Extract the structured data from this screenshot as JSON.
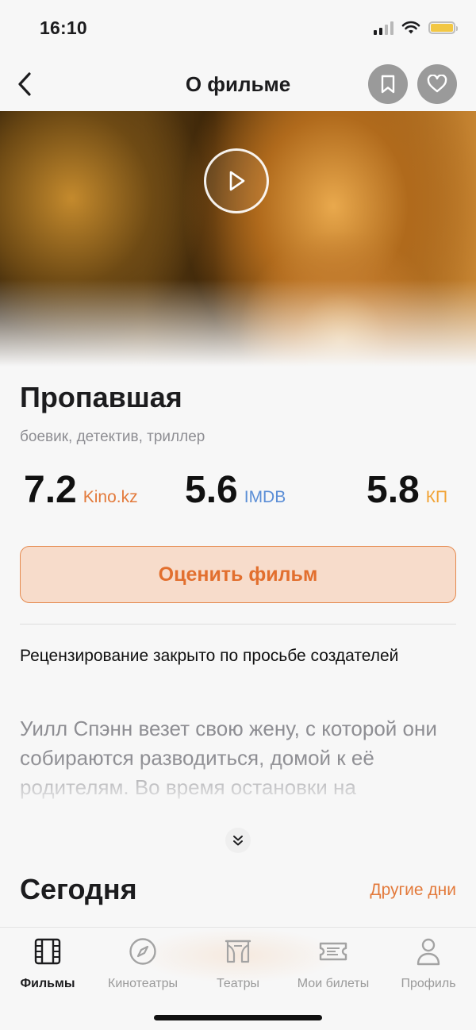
{
  "status_bar": {
    "time": "16:10"
  },
  "nav": {
    "title": "О фильме"
  },
  "movie": {
    "title": "Пропавшая",
    "genres": "боевик, детектив, триллер",
    "ratings": [
      {
        "value": "7.2",
        "source": "Kino.kz",
        "color": "#e37a3b"
      },
      {
        "value": "5.6",
        "source": "IMDB",
        "color": "#5b8ed6"
      },
      {
        "value": "5.8",
        "source": "КП",
        "color": "#f2a334"
      }
    ],
    "rate_button": "Оценить фильм",
    "review_note": "Рецензирование закрыто по просьбе создателей",
    "description": "Уилл Спэнн везет свою жену, с которой они собираются разводиться, домой к её родителям. Во время остановки на"
  },
  "schedule": {
    "title": "Сегодня",
    "other_days": "Другие дни"
  },
  "tabs": [
    {
      "label": "Фильмы",
      "icon": "film-icon",
      "active": true
    },
    {
      "label": "Кинотеатры",
      "icon": "compass-icon",
      "active": false
    },
    {
      "label": "Театры",
      "icon": "theater-icon",
      "active": false
    },
    {
      "label": "Мои билеты",
      "icon": "ticket-icon",
      "active": false
    },
    {
      "label": "Профиль",
      "icon": "profile-icon",
      "active": false
    }
  ],
  "colors": {
    "accent": "#e37a3b",
    "accent_bg": "#f7dccb",
    "imdb": "#5b8ed6",
    "kp": "#f2a334"
  }
}
